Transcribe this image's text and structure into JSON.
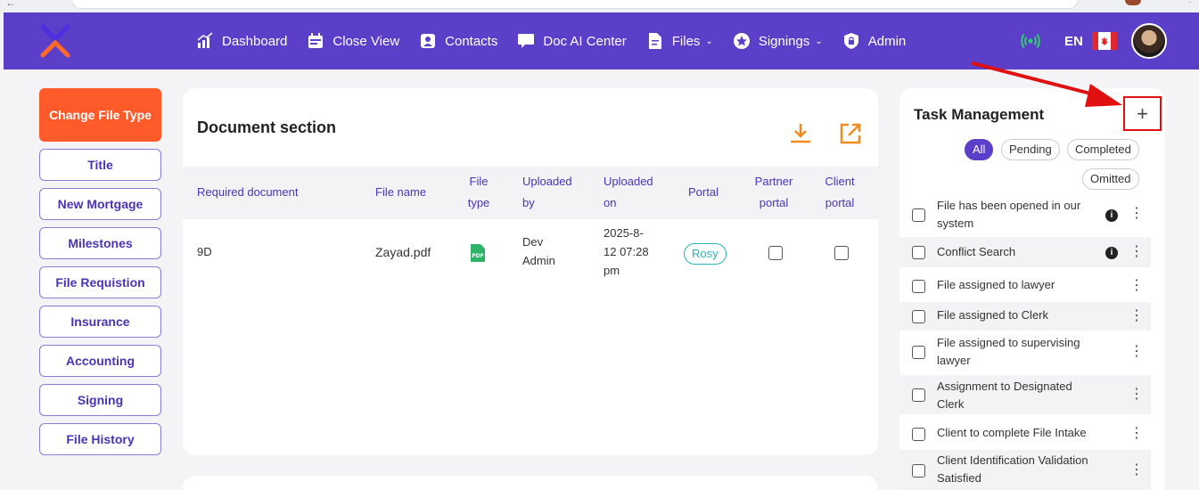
{
  "nav": {
    "items": [
      {
        "label": "Dashboard",
        "icon": "chart-icon"
      },
      {
        "label": "Close View",
        "icon": "calendar-icon"
      },
      {
        "label": "Contacts",
        "icon": "contact-icon"
      },
      {
        "label": "Doc AI Center",
        "icon": "chat-icon"
      },
      {
        "label": "Files",
        "icon": "file-icon",
        "dropdown": true
      },
      {
        "label": "Signings",
        "icon": "star-icon",
        "dropdown": true
      },
      {
        "label": "Admin",
        "icon": "lock-icon"
      }
    ],
    "language": "EN"
  },
  "left_menu": {
    "primary": "Change File Type",
    "items": [
      "Title",
      "New Mortgage",
      "Milestones",
      "File Requistion",
      "Insurance",
      "Accounting",
      "Signing",
      "File History"
    ]
  },
  "document": {
    "title": "Document section",
    "headers": {
      "required": "Required document",
      "file_name": "File name",
      "file_type": "File type",
      "uploaded_by": "Uploaded by",
      "uploaded_on": "Uploaded on",
      "portal": "Portal",
      "partner_portal": "Partner portal",
      "client_portal": "Client portal"
    },
    "rows": [
      {
        "required": "9D",
        "file_name": "Zayad.pdf",
        "file_type": "PDF",
        "uploaded_by": "Dev Admin",
        "uploaded_on": "2025-8-12 07:28 pm",
        "portal": "Rosy",
        "partner_portal": false,
        "client_portal": false
      }
    ]
  },
  "tasks": {
    "title": "Task Management",
    "add_label": "+",
    "filters": [
      "All",
      "Pending",
      "Completed",
      "Omitted"
    ],
    "active_filter": "All",
    "items": [
      {
        "label": "File has been opened in our system",
        "info": true
      },
      {
        "label": "Conflict Search",
        "info": true
      },
      {
        "label": "File assigned to lawyer",
        "info": false
      },
      {
        "label": "File assigned to Clerk",
        "info": false
      },
      {
        "label": "File assigned to supervising lawyer",
        "info": false
      },
      {
        "label": "Assignment to Designated Clerk",
        "info": false
      },
      {
        "label": "Client to complete File Intake",
        "info": false
      },
      {
        "label": "Client Identification Validation Satisfied",
        "info": false
      }
    ]
  },
  "colors": {
    "brand": "#5b3fc8",
    "accent": "#ff5a2a",
    "highlight": "#e01010"
  }
}
